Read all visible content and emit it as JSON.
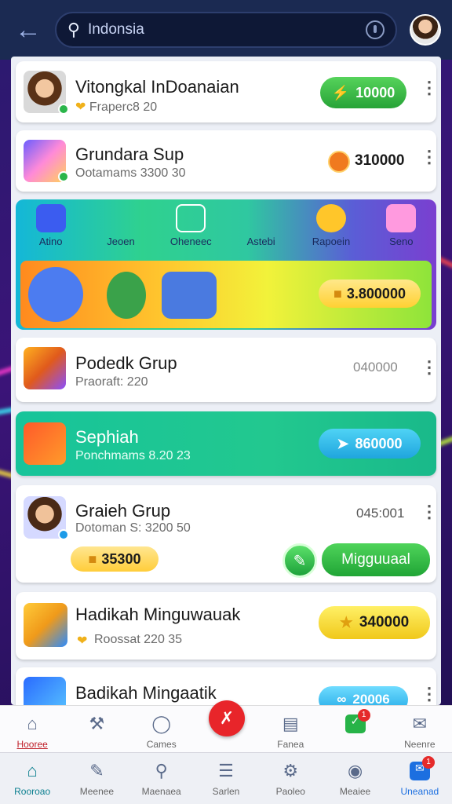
{
  "search": {
    "value": "Indonsia"
  },
  "cards": [
    {
      "title": "Vitongkal InDoanaian",
      "sub": "Fraperc8 20",
      "pill": "10000"
    },
    {
      "title": "Grundara Sup",
      "sub": "Ootamams 3300 30",
      "value": "310000"
    },
    {
      "title": "Podedk Grup",
      "sub": "Praoraft: 220",
      "value": "040000"
    },
    {
      "title": "Sephiah",
      "sub": "Ponchmams 8.20 23",
      "pill": "860000"
    },
    {
      "title": "Graieh Grup",
      "sub": "Dotoman S: 3200 50",
      "value": "045:001",
      "gold": "35300",
      "action": "Migguuaal"
    },
    {
      "title": "Hadikah Minguwauak",
      "sub": "Roossat 220 35",
      "pill": "340000"
    },
    {
      "title": "Badikah Mingaatik",
      "pill": "20006"
    }
  ],
  "promo": {
    "categories": [
      "Atino",
      "Jeoen",
      "Oheneec",
      "Astebi",
      "Rapoein",
      "Seno"
    ],
    "banner_value": "3.800000"
  },
  "nav_top": [
    "Hooree",
    "",
    "Cames",
    "",
    "Fanea",
    "",
    "Neenre"
  ],
  "nav_bottom": [
    "Rooroao",
    "Meenee",
    "Maenaea",
    "Sarlen",
    "Paoleo",
    "Meaiee",
    "Uneanad"
  ],
  "badges": {
    "nav_top_chat": "1",
    "nav_bottom_inbox": "1"
  },
  "colors": {
    "accent_green": "#27a337",
    "accent_teal": "#0b7f8f",
    "fab_red": "#e8252a"
  }
}
